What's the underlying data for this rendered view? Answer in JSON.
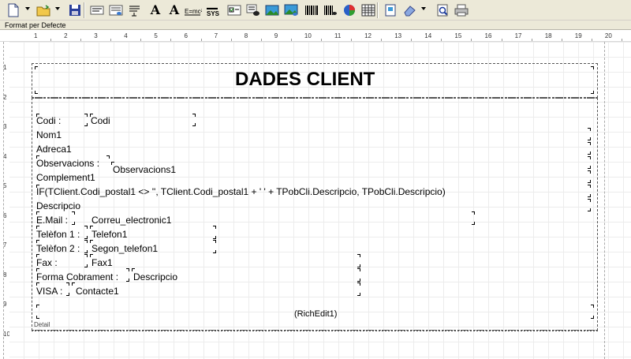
{
  "toolbar": {
    "buttons": [
      {
        "icon": "new-document-icon",
        "glyph": "🗋"
      },
      {
        "icon": "open-folder-icon",
        "glyph": "📂"
      },
      {
        "icon": "save-icon",
        "glyph": "💾"
      },
      {
        "icon": "label-field-icon",
        "glyph": "▤"
      },
      {
        "icon": "db-field-icon",
        "glyph": "▦"
      },
      {
        "icon": "memo-field-icon",
        "glyph": "☰"
      },
      {
        "icon": "font-icon",
        "glyph": "A"
      },
      {
        "icon": "font-size-icon",
        "glyph": "A"
      },
      {
        "icon": "expression-icon",
        "glyph": "Σ"
      },
      {
        "icon": "system-data-icon",
        "glyph": "⚙"
      },
      {
        "icon": "checkbox-icon",
        "glyph": "☑"
      },
      {
        "icon": "dbcheckbox-icon",
        "glyph": "☒"
      },
      {
        "icon": "image-icon",
        "glyph": "▣"
      },
      {
        "icon": "dbimage-icon",
        "glyph": "▧"
      },
      {
        "icon": "barcode-icon",
        "glyph": "▥"
      },
      {
        "icon": "dbbarcode-icon",
        "glyph": "▥"
      },
      {
        "icon": "chart-icon",
        "glyph": "◕"
      },
      {
        "icon": "grid-icon",
        "glyph": "#"
      },
      {
        "icon": "page-setup-icon",
        "glyph": "▯"
      },
      {
        "icon": "eraser-icon",
        "glyph": "⌫"
      },
      {
        "icon": "preview-icon",
        "glyph": "🔍"
      },
      {
        "icon": "print-icon",
        "glyph": "⎙"
      }
    ]
  },
  "formatbar": {
    "label": "Format per Defecte"
  },
  "ruler": {
    "h_numbers": [
      "1",
      "2",
      "3",
      "4",
      "5",
      "6",
      "7",
      "8",
      "9",
      "10",
      "11",
      "12",
      "13",
      "14",
      "15",
      "16",
      "17",
      "18",
      "19",
      "20"
    ],
    "v_numbers": [
      "1",
      "2",
      "3",
      "4",
      "5",
      "6",
      "7",
      "8",
      "9",
      "10"
    ]
  },
  "report": {
    "title": "DADES CLIENT",
    "band_name": "Detail",
    "fields": {
      "codi_label": "Codi :",
      "codi_value": "Codi",
      "nom": "Nom1",
      "adreca": "Adreca1",
      "observacions_label": "Observacions :",
      "observacions_value": "Observacions1",
      "complement": "Complement1",
      "expression": "IF(TClient.Codi_postal1 <> '', TClient.Codi_postal1 + ' ' + TPobCli.Descripcio, TPobCli.Descripcio)",
      "descripcio": "Descripcio",
      "email_label": "E.Mail :",
      "email_value": "Correu_electronic1",
      "telefon1_label": "Telèfon 1 :",
      "telefon1_value": "Telefon1",
      "telefon2_label": "Telèfon 2 :",
      "telefon2_value": "Segon_telefon1",
      "fax_label": "Fax :",
      "fax_value": "Fax1",
      "forma_label": "Forma Cobrament :",
      "forma_value": "Descripcio",
      "visa_label": "VISA :",
      "visa_value": "Contacte1",
      "richedit": "(RichEdit1)"
    }
  }
}
